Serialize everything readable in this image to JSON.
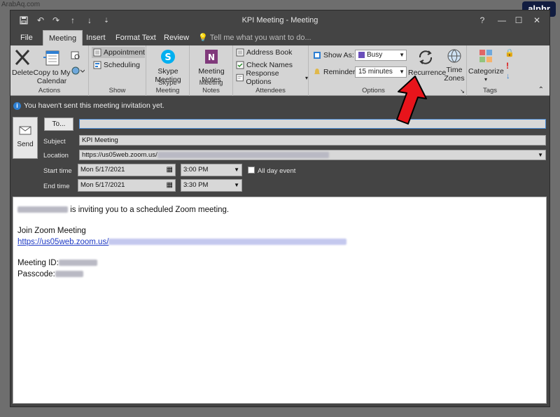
{
  "watermark": "ArabAq.com",
  "brand": "alphr",
  "window": {
    "title": "KPI Meeting - Meeting",
    "qat": [
      "save-icon",
      "undo-icon",
      "redo-icon",
      "up-arrow-icon",
      "down-arrow-icon",
      "customize-icon"
    ],
    "controls": [
      "?",
      "—",
      "☐",
      "✕"
    ]
  },
  "tabs": [
    {
      "label": "File",
      "active": false
    },
    {
      "label": "Meeting",
      "active": true
    },
    {
      "label": "Insert",
      "active": false
    },
    {
      "label": "Format Text",
      "active": false
    },
    {
      "label": "Review",
      "active": false
    }
  ],
  "tell_me": "Tell me what you want to do...",
  "ribbon": {
    "actions": {
      "label": "Actions",
      "delete": "Delete",
      "copy_line1": "Copy to My",
      "copy_line2": "Calendar"
    },
    "show": {
      "label": "Show",
      "appointment": "Appointment",
      "scheduling": "Scheduling"
    },
    "skype": {
      "label": "Skype Meeting",
      "btn_line1": "Skype",
      "btn_line2": "Meeting"
    },
    "notes": {
      "label": "Meeting Notes",
      "btn_line1": "Meeting",
      "btn_line2": "Notes"
    },
    "attendees": {
      "label": "Attendees",
      "address_book": "Address Book",
      "check_names": "Check Names",
      "response_options": "Response Options"
    },
    "options": {
      "label": "Options",
      "show_as_label": "Show As:",
      "show_as_value": "Busy",
      "reminder_label": "Reminder:",
      "reminder_value": "15 minutes",
      "recurrence": "Recurrence",
      "time_zones_line1": "Time",
      "time_zones_line2": "Zones"
    },
    "tags": {
      "label": "Tags",
      "categorize": "Categorize"
    }
  },
  "infobar": "You haven't sent this meeting invitation yet.",
  "form": {
    "send": "Send",
    "to_button": "To...",
    "subject_label": "Subject",
    "subject_value": "KPI Meeting",
    "location_label": "Location",
    "location_value": "https://us05web.zoom.us/",
    "start_label": "Start time",
    "start_date": "Mon 5/17/2021",
    "start_time": "3:00 PM",
    "all_day": "All day event",
    "end_label": "End time",
    "end_date": "Mon 5/17/2021",
    "end_time": "3:30 PM"
  },
  "body": {
    "line1": "is inviting you to a scheduled Zoom meeting.",
    "line2": "Join Zoom Meeting",
    "link": "https://us05web.zoom.us/",
    "meeting_id": "Meeting ID:",
    "passcode": "Passcode:"
  },
  "colors": {
    "accent": "#2d7fd3",
    "arrow": "#e8141b",
    "busy": "#6b4fbb"
  }
}
